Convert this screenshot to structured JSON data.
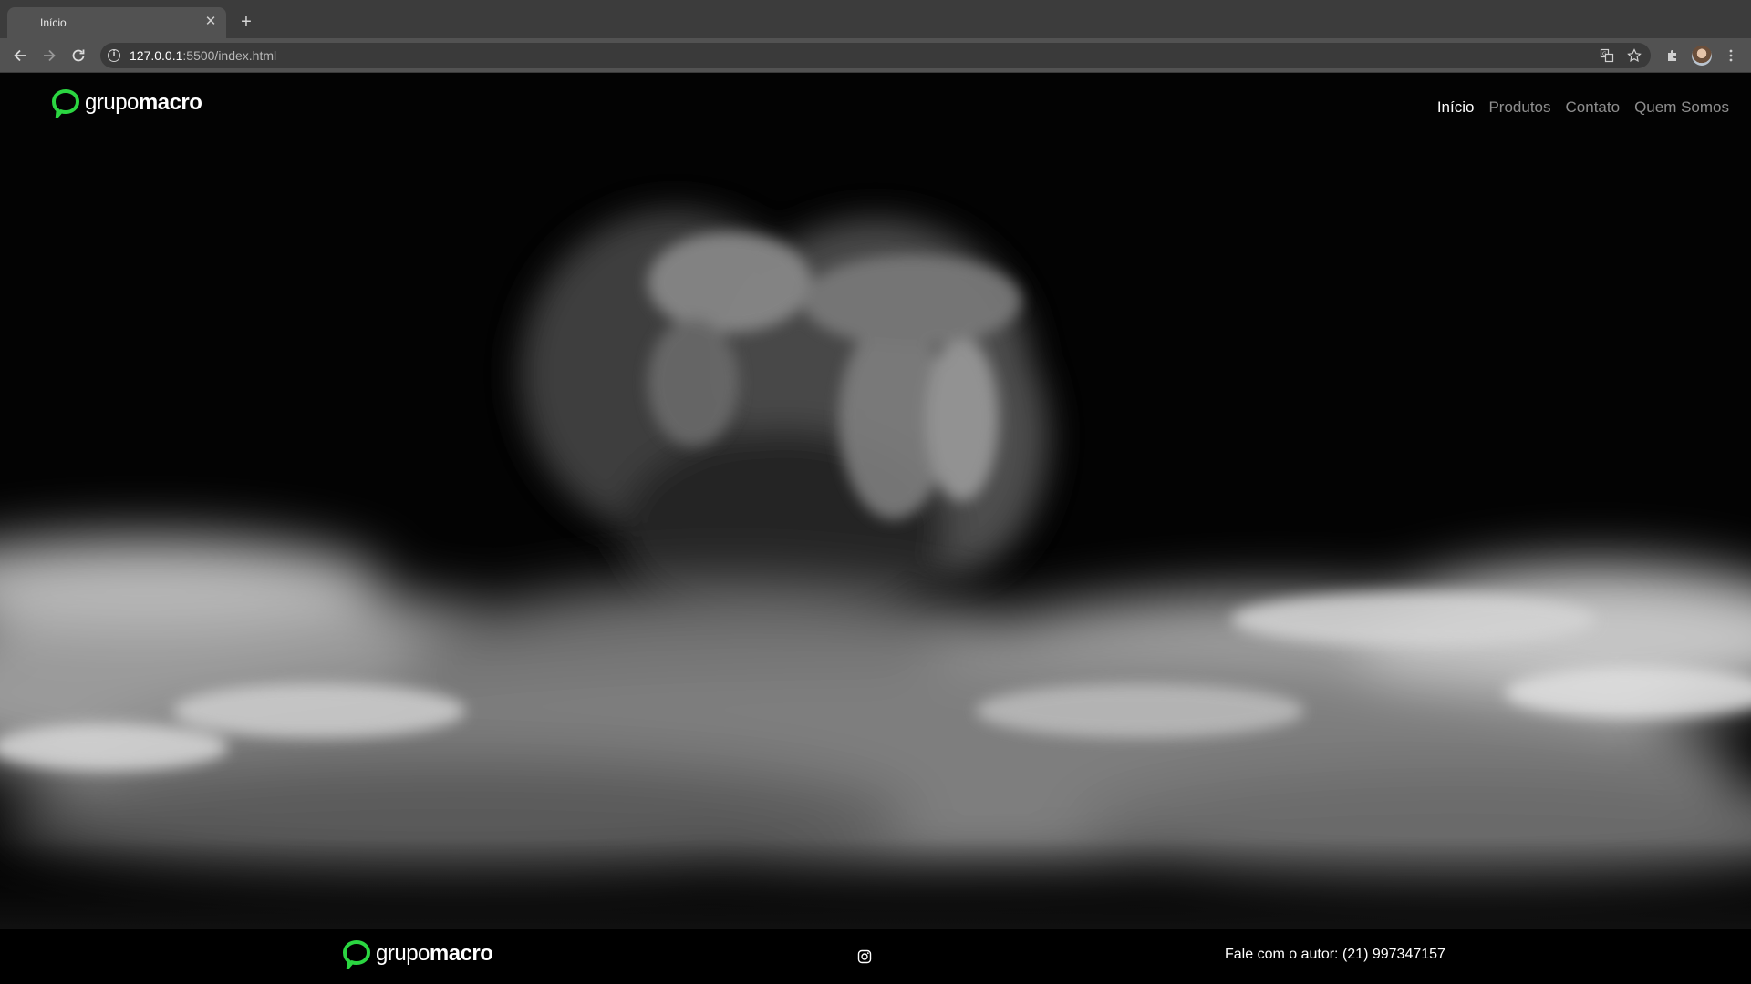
{
  "browser": {
    "tab_title": "Início",
    "url_host": "127.0.0.1",
    "url_rest": ":5500/index.html",
    "icons": [
      "back-arrow-icon",
      "forward-arrow-icon",
      "reload-icon",
      "info-icon",
      "translate-icon",
      "star-icon",
      "extensions-icon",
      "profile-avatar",
      "menu-dots-icon"
    ]
  },
  "site": {
    "logo": {
      "light": "grupo",
      "bold": "macro",
      "accent": "#2bd641"
    },
    "nav": [
      {
        "label": "Início",
        "active": true
      },
      {
        "label": "Produtos",
        "active": false
      },
      {
        "label": "Contato",
        "active": false
      },
      {
        "label": "Quem Somos",
        "active": false
      }
    ],
    "hero_image": "black-and-white multiple-exposure portrait of a woman above rolling fog"
  },
  "footer": {
    "logo": {
      "light": "grupo",
      "bold": "macro"
    },
    "instagram_icon": "instagram-icon",
    "contact_text": "Fale com o autor: (21) 997347157"
  }
}
